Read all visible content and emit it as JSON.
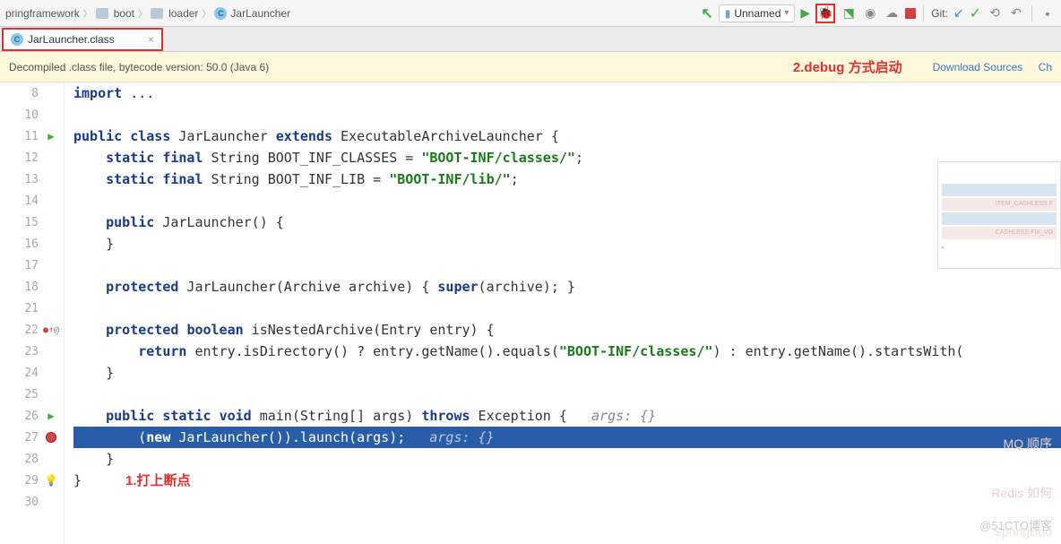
{
  "breadcrumbs": [
    "pringframework",
    "boot",
    "loader",
    "JarLauncher"
  ],
  "runConfig": "Unnamed",
  "gitLabel": "Git:",
  "tab": {
    "name": "JarLauncher.class"
  },
  "banner": {
    "text": "Decompiled .class file, bytecode version: 50.0 (Java 6)",
    "annotation2": "2.debug 方式启动",
    "download": "Download Sources",
    "choose": "Ch"
  },
  "annotation1": "1.打上断点",
  "watermark": "@51CTO博客",
  "faint1": "MQ 顺序",
  "faint2": "Redis 如何",
  "faint3": "SpringBoo",
  "code": {
    "l8": {
      "pre": "",
      "kw": "import",
      "rest": " ..."
    },
    "l11": {
      "pre": "",
      "t": [
        [
          "public",
          "kw"
        ],
        [
          " ",
          "p"
        ],
        [
          "class",
          "kw"
        ],
        [
          " JarLauncher ",
          "p"
        ],
        [
          "extends",
          "kw"
        ],
        [
          " ExecutableArchiveLauncher {",
          "p"
        ]
      ]
    },
    "l12": {
      "pre": "    ",
      "t": [
        [
          "static",
          "kw"
        ],
        [
          " ",
          "p"
        ],
        [
          "final",
          "kw"
        ],
        [
          " String BOOT_INF_CLASSES = ",
          "p"
        ],
        [
          "\"BOOT-INF/classes/\"",
          "str"
        ],
        [
          ";",
          "p"
        ]
      ]
    },
    "l13": {
      "pre": "    ",
      "t": [
        [
          "static",
          "kw"
        ],
        [
          " ",
          "p"
        ],
        [
          "final",
          "kw"
        ],
        [
          " String BOOT_INF_LIB = ",
          "p"
        ],
        [
          "\"BOOT-INF/lib/\"",
          "str"
        ],
        [
          ";",
          "p"
        ]
      ]
    },
    "l15": {
      "pre": "    ",
      "t": [
        [
          "public",
          "kw"
        ],
        [
          " JarLauncher() {",
          "p"
        ]
      ]
    },
    "l16": {
      "pre": "    ",
      "t": [
        [
          "}",
          "p"
        ]
      ]
    },
    "l18": {
      "pre": "    ",
      "t": [
        [
          "protected",
          "kw"
        ],
        [
          " JarLauncher(Archive archive) { ",
          "p"
        ],
        [
          "super",
          "kw"
        ],
        [
          "(archive); }",
          "p"
        ]
      ]
    },
    "l22": {
      "pre": "    ",
      "t": [
        [
          "protected",
          "kw"
        ],
        [
          " ",
          "p"
        ],
        [
          "boolean",
          "kw"
        ],
        [
          " isNestedArchive(Entry entry) {",
          "p"
        ]
      ]
    },
    "l23": {
      "pre": "        ",
      "t": [
        [
          "return",
          "kw"
        ],
        [
          " entry.isDirectory() ? entry.getName().equals(",
          "p"
        ],
        [
          "\"BOOT-INF/classes/\"",
          "str"
        ],
        [
          ") : entry.getName().startsWith(",
          "p"
        ]
      ]
    },
    "l24": {
      "pre": "    ",
      "t": [
        [
          "}",
          "p"
        ]
      ]
    },
    "l26": {
      "pre": "    ",
      "t": [
        [
          "public",
          "kw"
        ],
        [
          " ",
          "p"
        ],
        [
          "static",
          "kw"
        ],
        [
          " ",
          "p"
        ],
        [
          "void",
          "kw"
        ],
        [
          " main(String[] args) ",
          "p"
        ],
        [
          "throws",
          "kw"
        ],
        [
          " Exception {   ",
          "p"
        ],
        [
          "args: {}",
          "cmt"
        ]
      ]
    },
    "l27": {
      "pre": "        ",
      "t": [
        [
          "(",
          "p"
        ],
        [
          "new",
          "kw"
        ],
        [
          " JarLauncher()).launch(args);   ",
          "p"
        ],
        [
          "args: {}",
          "cmt"
        ]
      ]
    },
    "l28": {
      "pre": "    ",
      "t": [
        [
          "}",
          "p"
        ]
      ]
    },
    "l29": {
      "pre": "",
      "t": [
        [
          "}",
          "p"
        ]
      ]
    }
  },
  "lines": [
    "8",
    "10",
    "11",
    "12",
    "13",
    "14",
    "15",
    "16",
    "17",
    "18",
    "21",
    "22",
    "23",
    "24",
    "25",
    "26",
    "27",
    "28",
    "29",
    "30"
  ]
}
